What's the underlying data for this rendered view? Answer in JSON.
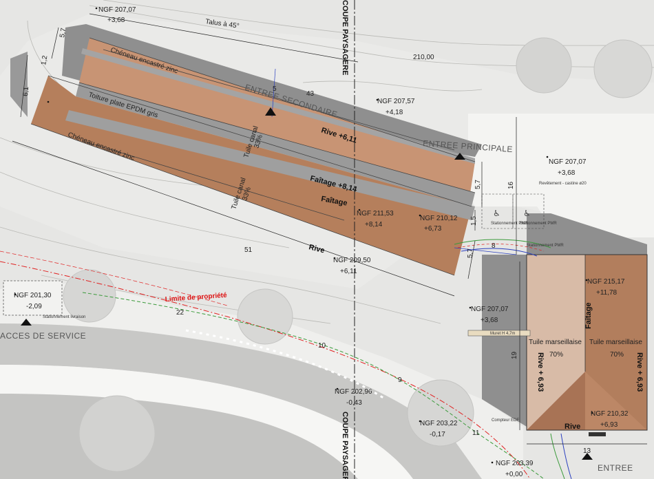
{
  "labels": {
    "ngf_20707_top": "NGF 207,07",
    "ngf_20707_top_h": "+3,68",
    "talus": "Talus à 45°",
    "contour_210": "210,00",
    "coupe_top": "COUPE PAYSAGERE",
    "coupe_bottom": "COUPE PAYSAGERE",
    "cheneau_top": "Chéneau encastré zinc",
    "cheneau_bottom": "Chéneau encastré zinc",
    "toiture_plate": "Toiture plate EPDM gris",
    "entree_secondaire": "ENTREE SECONDAIRE",
    "entree_principale": "ENTREE PRINCIPALE",
    "ngf_20757": "NGF 207,57",
    "ngf_20757_h": "+4,18",
    "rive_611": "Rive +6,11",
    "tuile_canal_1": "Tuile canal",
    "tuile_canal_1_pct": "33%",
    "tuile_canal_2": "Tuile canal",
    "tuile_canal_2_pct": "33%",
    "faitage_814": "Faîtage +8,14",
    "faitage": "Faîtage",
    "ngf_21153": "NGF 211,53",
    "ngf_21153_h": "+8,14",
    "ngf_21012": "NGF 210,12",
    "ngf_21012_h": "+6,73",
    "rive": "Rive",
    "ngf_20950": "NGF 209,50",
    "ngf_20950_h": "+6,11",
    "ngf_20707_right": "NGF 207,07",
    "ngf_20707_right_h": "+3,68",
    "revetement": "Revêtement - castine ø20",
    "pmr_1": "Stationnement PMR",
    "pmr_2": "Stationnement PMR",
    "pmr_3": "Stationnement PMR",
    "ngf_20130": "NGF 201,30",
    "ngf_20130_h": "-2,09",
    "stationnement_livraison": "Stationnement livraison",
    "acces_service": "ACCES DE SERVICE",
    "limite_propriete": "Limite de propriété",
    "ngf_20707_mid": "NGF 207,07",
    "ngf_20707_mid_h": "+3,68",
    "muret": "Muret H 4,7m",
    "ngf_21517": "NGF 215,17",
    "ngf_21517_h": "+11,78",
    "faitage_house": "Faîtage",
    "tuile_marseillaise_l": "Tuile marseillaise",
    "tuile_marseillaise_l_pct": "70%",
    "tuile_marseillaise_r": "Tuile marseillaise",
    "tuile_marseillaise_r_pct": "70%",
    "rive_693_l": "Rive + 6,93",
    "rive_693_r": "Rive + 6,93",
    "ngf_21032": "NGF 210,32",
    "ngf_21032_h": "+6,93",
    "rive_house": "Rive",
    "compteur": "Compteur EDF",
    "entree": "ENTREE",
    "ngf_20296": "NGF 202,96",
    "ngf_20296_h": "-0,43",
    "ngf_20322": "NGF 203,22",
    "ngf_20322_h": "-0,17",
    "ngf_20339": "NGF 203,39",
    "ngf_20339_h": "+0,00"
  },
  "dimensions": {
    "d_57_top": "5,7",
    "d_12": "1,2",
    "d_61": "6,1",
    "d_5": "5",
    "d_43": "43",
    "d_16": "16",
    "d_57_right": "5,7",
    "d_15": "1,5",
    "d_8": "8",
    "d_57_low": "5,7",
    "d_51": "51",
    "d_22": "22",
    "d_10": "10",
    "d_9": "9",
    "d_11": "11",
    "d_19": "19",
    "d_13": "13"
  },
  "colors": {
    "background": "#e6e6e4",
    "terrain_light": "#f4f4f2",
    "road_grey": "#c8c8c6",
    "shadow": "#8f8f8f",
    "roof_canal": "#b57f5c",
    "roof_canal_light": "#c89474",
    "roof_flat": "#9a9a9a",
    "roof_marseillaise_light": "#d8bba7",
    "roof_marseillaise": "#b27e5d",
    "property_line": "#e02020",
    "path_green": "#3a9a3a",
    "path_blue": "#2a3fbf"
  }
}
